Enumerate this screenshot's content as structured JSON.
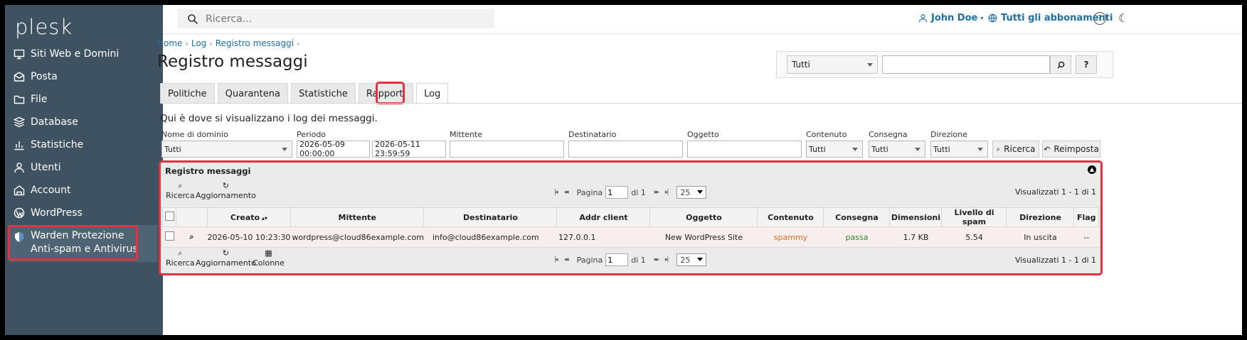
{
  "brand": {
    "logo": "plesk"
  },
  "sidebar": {
    "items": [
      {
        "label": "Siti Web e Domini",
        "icon": "monitor-icon"
      },
      {
        "label": "Posta",
        "icon": "mail-icon"
      },
      {
        "label": "File",
        "icon": "folder-icon"
      },
      {
        "label": "Database",
        "icon": "database-icon"
      },
      {
        "label": "Statistiche",
        "icon": "chart-icon"
      },
      {
        "label": "Utenti",
        "icon": "user-icon"
      },
      {
        "label": "Account",
        "icon": "account-icon"
      },
      {
        "label": "WordPress",
        "icon": "wordpress-icon"
      }
    ],
    "active": {
      "label": "Warden Protezione Anti-spam e Antivirus",
      "icon": "shield-icon"
    }
  },
  "topbar": {
    "search_placeholder": "Ricerca...",
    "user": "John Doe",
    "subscriptions": "Tutti gli abbonamenti"
  },
  "breadcrumb": [
    "Home",
    "Log",
    "Registro messaggi"
  ],
  "page_title": "Registro messaggi",
  "top_filter": {
    "select": "Tutti",
    "search_button": "search-icon",
    "help_label": "?"
  },
  "tabs": [
    "Politiche",
    "Quarantena",
    "Statistiche",
    "Rapporti",
    "Log"
  ],
  "active_tab": "Log",
  "intro": "Qui è dove si visualizzano i log dei messaggi.",
  "filters": {
    "domain_label": "Nome di dominio",
    "domain_value": "Tutti",
    "period_label": "Periodo",
    "period_from": "2026-05-09 00:00:00",
    "period_to": "2026-05-11 23:59:59",
    "sender_label": "Mittente",
    "recipient_label": "Destinatario",
    "subject_label": "Oggetto",
    "content_label": "Contenuto",
    "content_value": "Tutti",
    "delivery_label": "Consegna",
    "delivery_value": "Tutti",
    "direction_label": "Direzione",
    "direction_value": "Tutti",
    "search_button": "Ricerca",
    "reset_button": "Reimposta"
  },
  "grid": {
    "title": "Registro messaggi",
    "tools_top": [
      "Ricerca",
      "Aggiornamento"
    ],
    "tools_bottom": [
      "Ricerca",
      "Aggiornamento",
      "Colonne"
    ],
    "page_label": "Pagina",
    "page_value": "1",
    "of_label": "di 1",
    "per_page": "25",
    "showing": "Visualizzati 1 - 1 di 1",
    "columns": [
      "Creato",
      "Mittente",
      "Destinatario",
      "Addr client",
      "Oggetto",
      "Contenuto",
      "Consegna",
      "Dimensioni",
      "Livello di spam",
      "Direzione",
      "Flag"
    ],
    "rows": [
      {
        "created": "2026-05-10 10:23:30",
        "sender": "wordpress@cloud86example.com",
        "recipient": "info@cloud86example.com",
        "client": "127.0.0.1",
        "subject": "New WordPress Site",
        "content": "spammy",
        "delivery": "passa",
        "size": "1.7 KB",
        "spam_level": "5.54",
        "direction": "In uscita",
        "flag": "--"
      }
    ]
  },
  "colors": {
    "sidebar": "#3f5261",
    "link": "#1d6fa5",
    "highlight": "#e03342",
    "spam": "#e0701a",
    "pass": "#2a8a2a"
  }
}
